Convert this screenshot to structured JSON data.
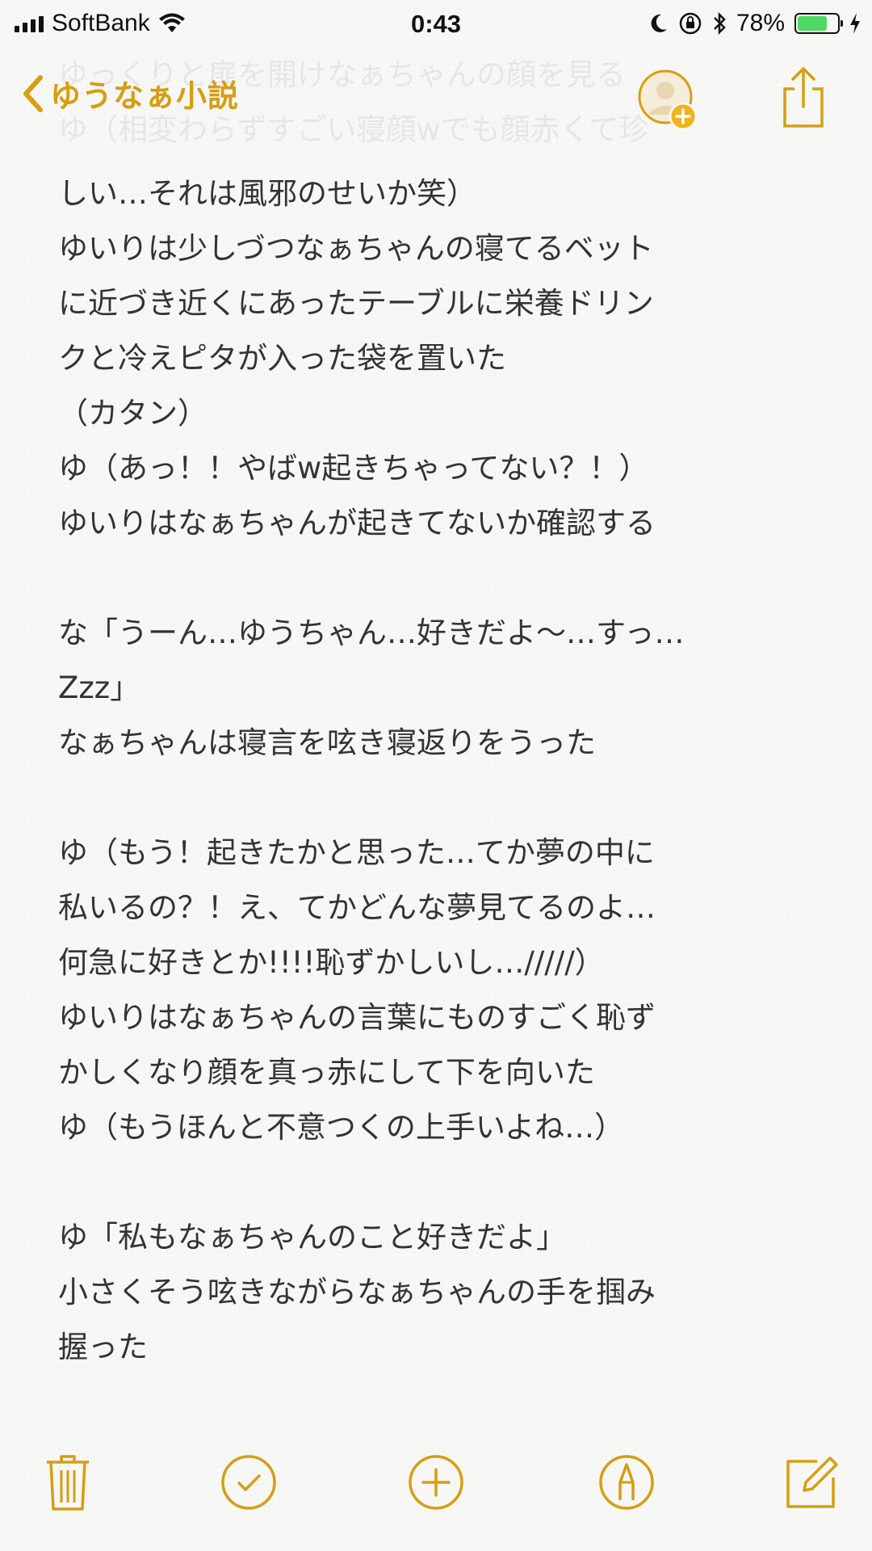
{
  "status_bar": {
    "carrier": "SoftBank",
    "time": "0:43",
    "battery_percent": "78%",
    "battery_level": 0.78,
    "icons": [
      "signal-icon",
      "wifi-icon",
      "moon-icon",
      "rotation-lock-icon",
      "bluetooth-icon",
      "battery-icon",
      "charging-icon"
    ]
  },
  "nav": {
    "back_label": "ゆうなぁ小説",
    "accent_color": "#d59e13"
  },
  "ghost_lines": [
    "ゆっくりと扉を開けなぁちゃんの顔を見る",
    "ゆ（相変わらずすごい寝顔wでも顔赤くて珍"
  ],
  "note_lines": [
    "しい…それは風邪のせいか笑）",
    "ゆいりは少しづつなぁちゃんの寝てるベット",
    "に近づき近くにあったテーブルに栄養ドリン",
    "クと冷えピタが入った袋を置いた",
    "（カタン）",
    "ゆ（あっ！！やばw起きちゃってない？！）",
    "ゆいりはなぁちゃんが起きてないか確認する",
    "",
    "な「うーん…ゆうちゃん…好きだよ〜…すっ…",
    "Zzz」",
    "なぁちゃんは寝言を呟き寝返りをうった",
    "",
    "ゆ（もう！起きたかと思った…てか夢の中に",
    "私いるの？！え、てかどんな夢見てるのよ…",
    "何急に好きとか!!!!恥ずかしいし…/////）",
    "ゆいりはなぁちゃんの言葉にものすごく恥ず",
    "かしくなり顔を真っ赤にして下を向いた",
    "ゆ（もうほんと不意つくの上手いよね…）",
    "",
    "ゆ「私もなぁちゃんのこと好きだよ」",
    "小さくそう呟きながらなぁちゃんの手を掴み",
    "握った"
  ],
  "toolbar": {
    "icons": [
      "trash-icon",
      "checklist-icon",
      "add-icon",
      "markup-icon",
      "compose-icon"
    ]
  }
}
